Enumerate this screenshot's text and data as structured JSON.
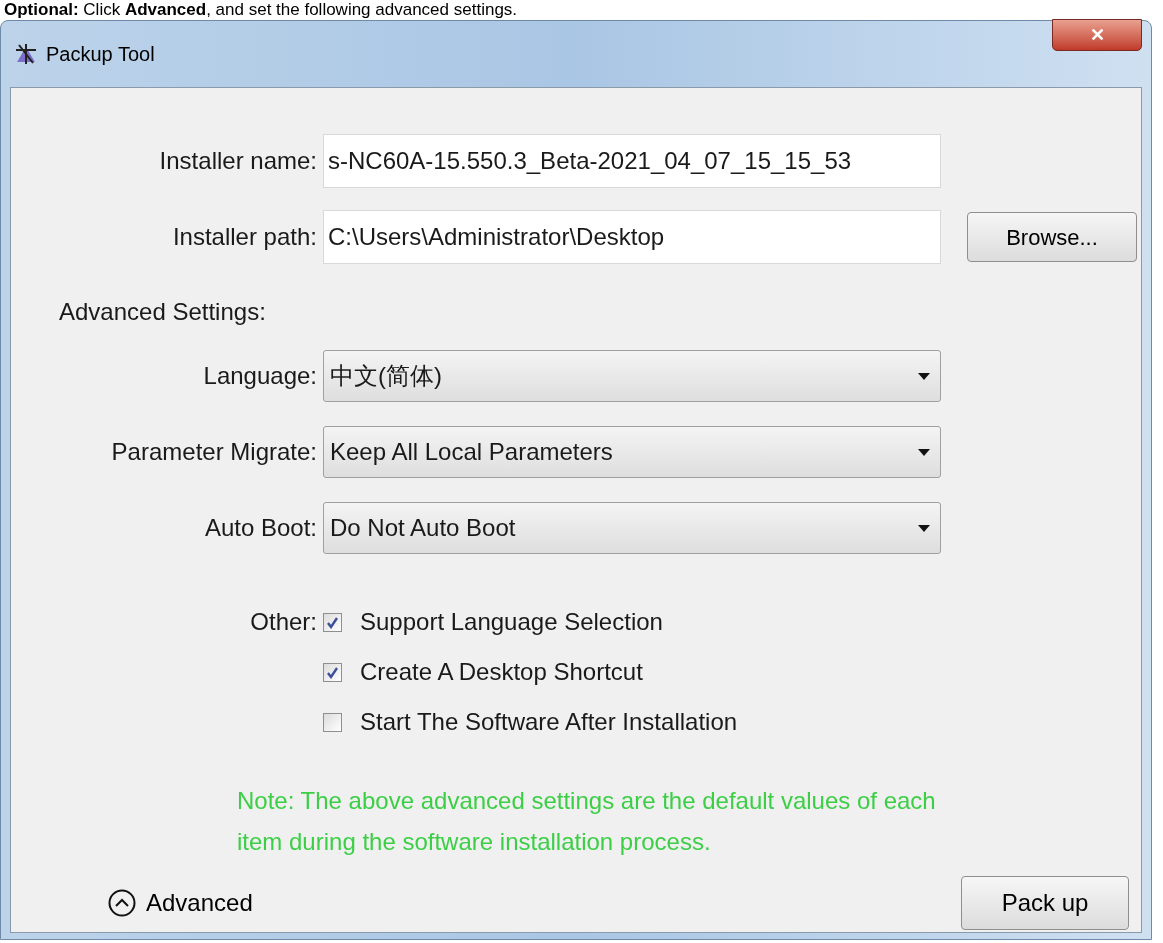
{
  "caption": "**Optional:** Click **Advanced**, and set the following advanced settings.",
  "window": {
    "title": "Packup Tool",
    "close": "✕"
  },
  "fields": [
    {
      "label": "Installer name:",
      "value": "s-NC60A-15.550.3_Beta-2021_04_07_15_15_53"
    },
    {
      "label": "Installer path:",
      "value": "C:\\Users\\Administrator\\Desktop",
      "button": "Browse..."
    }
  ],
  "advanced_heading": "Advanced Settings:",
  "dropdowns": [
    {
      "label": "Language:",
      "value": "中文(简体)"
    },
    {
      "label": "Parameter Migrate:",
      "value": "Keep All Local Parameters"
    },
    {
      "label": "Auto Boot:",
      "value": "Do Not Auto Boot"
    }
  ],
  "other_label": "Other:",
  "checkboxes": [
    {
      "label": "Support Language Selection",
      "checked": true
    },
    {
      "label": "Create A Desktop Shortcut",
      "checked": true
    },
    {
      "label": "Start The Software After Installation",
      "checked": false
    }
  ],
  "note": "Note: The above advanced settings are the default values of each item during the software installation process.",
  "advanced_toggle": {
    "label": "Advanced",
    "expanded": true
  },
  "pack_button": "Pack up"
}
